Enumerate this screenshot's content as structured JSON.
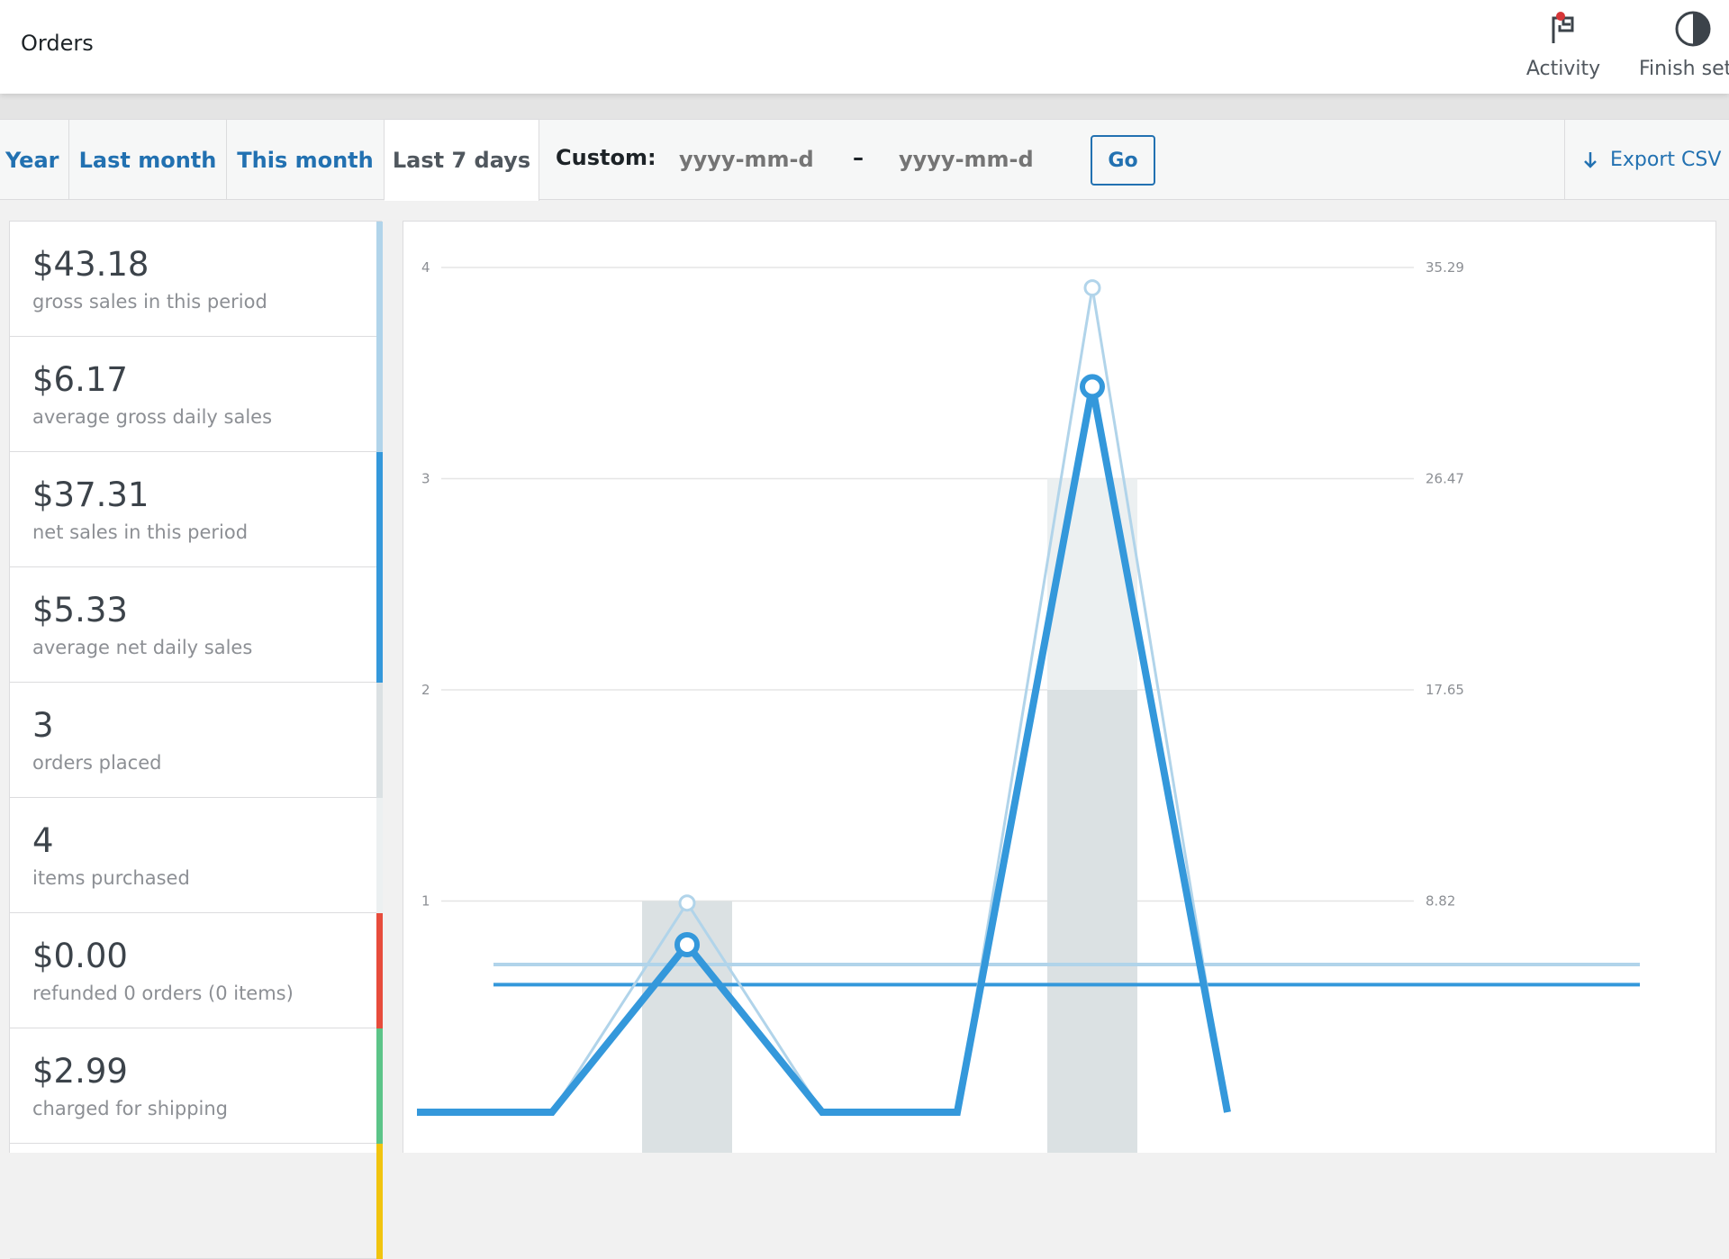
{
  "header": {
    "title": "Orders",
    "actions": [
      {
        "label": "Activity",
        "icon": "flag-icon"
      },
      {
        "label": "Finish setup",
        "icon": "half-circle-icon"
      }
    ]
  },
  "range_tabs": [
    "Year",
    "Last month",
    "This month",
    "Last 7 days"
  ],
  "active_range": "Last 7 days",
  "custom_range": {
    "label": "Custom:",
    "from_placeholder": "yyyy-mm-dd",
    "to_placeholder": "yyyy-mm-dd",
    "separator": "–",
    "go_label": "Go"
  },
  "export_label": "Export CSV",
  "stats": [
    {
      "amount": "$43.18",
      "desc": "gross sales in this period",
      "color": "#b1d4ea"
    },
    {
      "amount": "$6.17",
      "desc": "average gross daily sales",
      "color": "#b1d4ea"
    },
    {
      "amount": "$37.31",
      "desc": "net sales in this period",
      "color": "#3498db"
    },
    {
      "amount": "$5.33",
      "desc": "average net daily sales",
      "color": "#3498db"
    },
    {
      "amount": "3",
      "desc": "orders placed",
      "color": "#dbe1e3"
    },
    {
      "amount": "4",
      "desc": "items purchased",
      "color": "#ecf0f1"
    },
    {
      "amount": "$0.00",
      "desc": "refunded 0 orders (0 items)",
      "color": "#e74c3c"
    },
    {
      "amount": "$2.99",
      "desc": "charged for shipping",
      "color": "#5cc488"
    },
    {
      "amount": "",
      "desc": "",
      "color": "#f1c40f"
    }
  ],
  "chart_data": {
    "type": "bar",
    "left_axis": {
      "ticks": [
        "1",
        "2",
        "3",
        "4"
      ],
      "range": [
        0,
        4
      ]
    },
    "right_axis": {
      "ticks": [
        "8.82",
        "17.65",
        "26.47",
        "35.29"
      ],
      "range": [
        0,
        35.29
      ]
    },
    "grid": true,
    "days": 7,
    "series": [
      {
        "kind": "bar",
        "color": "#dbe1e3",
        "values": [
          0,
          0,
          1,
          0,
          0,
          2,
          0
        ]
      },
      {
        "kind": "bar",
        "color": "#ecf0f1",
        "values": [
          0,
          0,
          1,
          0,
          0,
          3,
          0
        ]
      },
      {
        "kind": "line",
        "color": "#b1d4ea",
        "values": [
          0,
          0,
          8.74,
          0,
          0,
          34.44,
          0
        ]
      },
      {
        "kind": "line",
        "color": "#3498db",
        "values": [
          0,
          0,
          7.0,
          0,
          0,
          30.31,
          0
        ]
      },
      {
        "kind": "average",
        "color": "#b1d4ea",
        "value": 6.17
      },
      {
        "kind": "average",
        "color": "#3498db",
        "value": 5.33
      }
    ]
  }
}
